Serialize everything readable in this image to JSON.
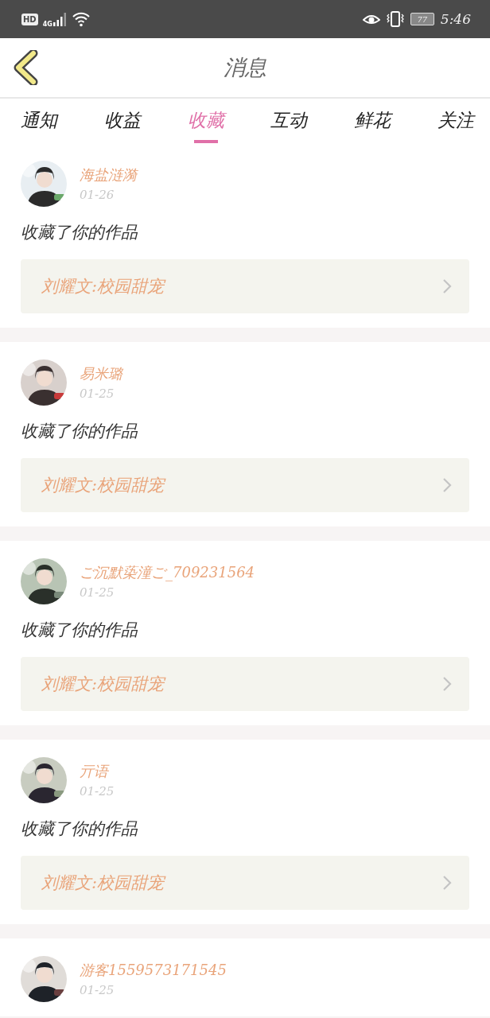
{
  "status_bar": {
    "hd": "HD",
    "network": "4G",
    "battery": "77",
    "time": "5:46"
  },
  "header": {
    "title": "消息"
  },
  "tabs": [
    {
      "label": "通知",
      "selected": false
    },
    {
      "label": "收益",
      "selected": false
    },
    {
      "label": "收藏",
      "selected": true
    },
    {
      "label": "互动",
      "selected": false
    },
    {
      "label": "鲜花",
      "selected": false
    },
    {
      "label": "关注",
      "selected": false
    }
  ],
  "messages": [
    {
      "name": "海盐涟漪",
      "date": "01-26",
      "action": "收藏了你的作品",
      "work": "刘耀文:校园甜宠"
    },
    {
      "name": "易米璐",
      "date": "01-25",
      "action": "收藏了你的作品",
      "work": "刘耀文:校园甜宠"
    },
    {
      "name": "ご沉默蒅潼ご_709231564",
      "date": "01-25",
      "action": "收藏了你的作品",
      "work": "刘耀文:校园甜宠"
    },
    {
      "name": "亓语",
      "date": "01-25",
      "action": "收藏了你的作品",
      "work": "刘耀文:校园甜宠"
    },
    {
      "name": "游客1559573171545",
      "date": "01-25"
    }
  ]
}
